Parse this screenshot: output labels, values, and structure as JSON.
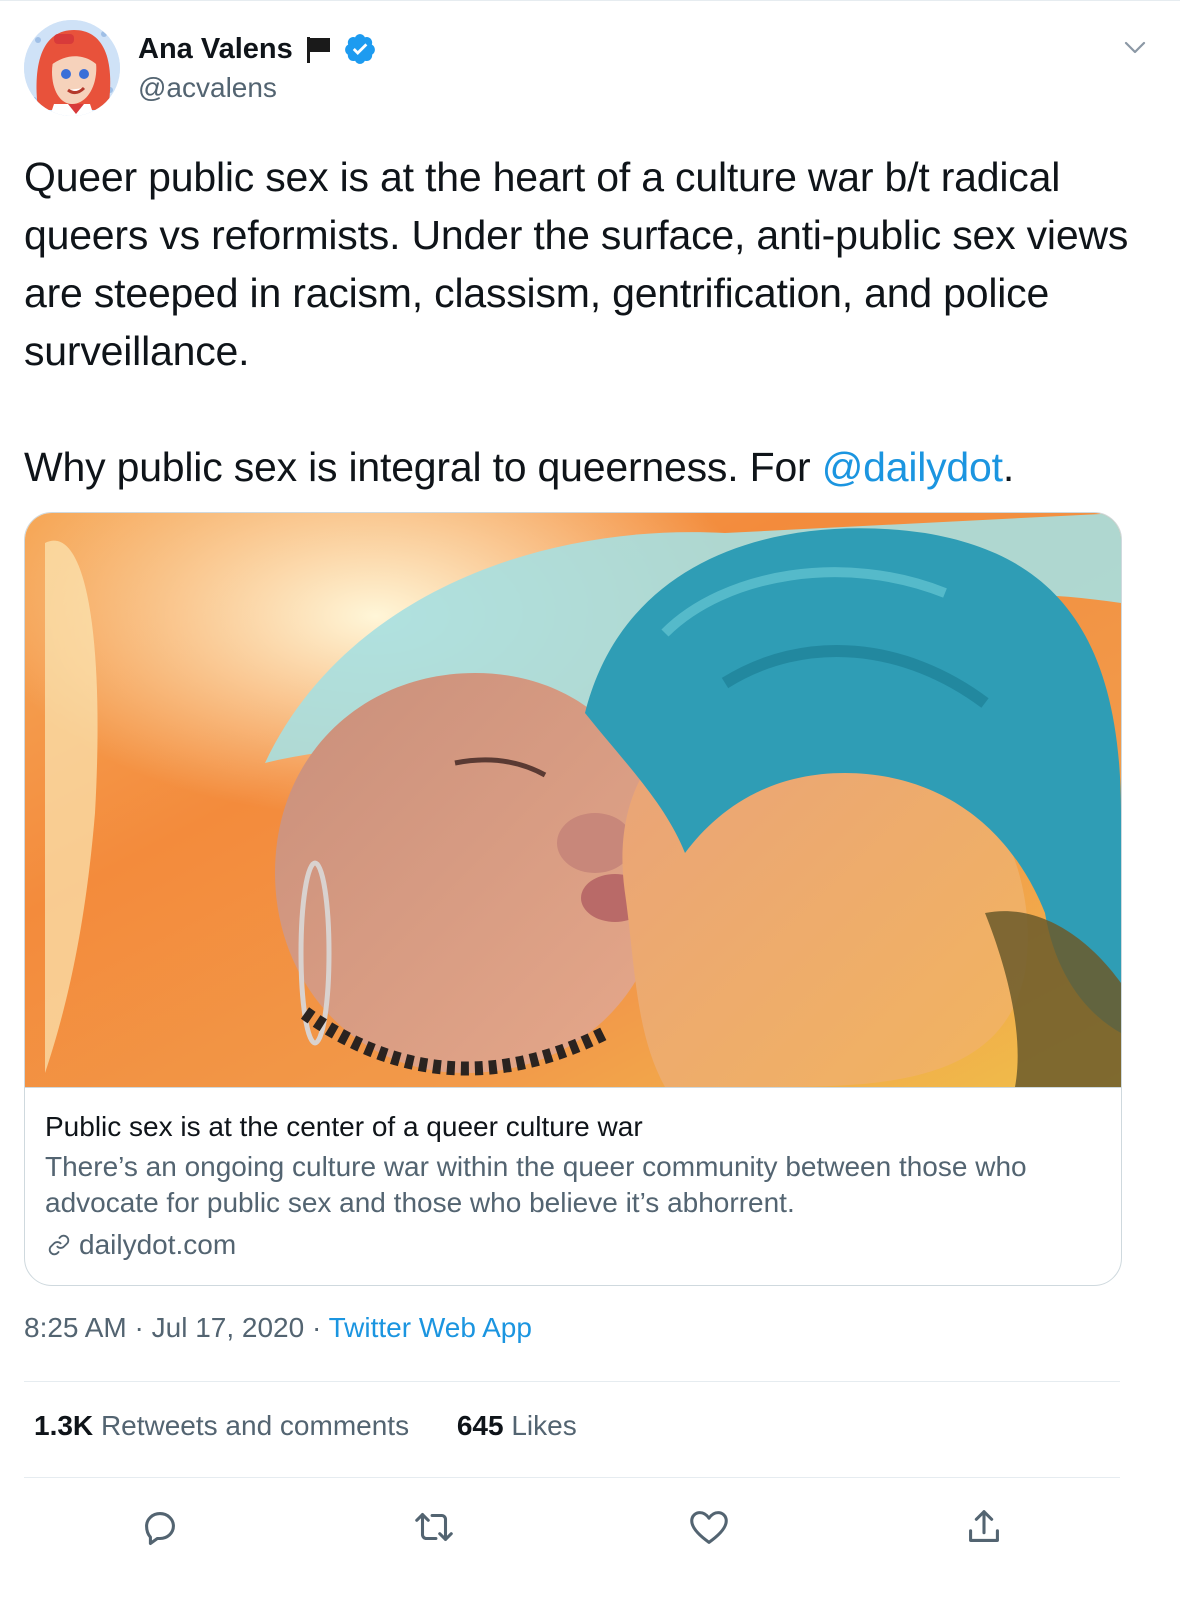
{
  "author": {
    "display_name": "Ana Valens",
    "handle": "@acvalens",
    "avatar_icon": "anime-avatar-icon",
    "flag_icon": "black-flag-icon",
    "verified_icon": "verified-badge-icon"
  },
  "tweet": {
    "paragraph1": "Queer public sex is at the heart of a culture war b/t radical queers vs reformists. Under the surface, anti-public sex views are steeped in racism, classism, gentrification, and police surveillance.",
    "paragraph2_prefix": "Why public sex is integral to queerness. For ",
    "mention": "@dailydot",
    "paragraph2_suffix": "."
  },
  "card": {
    "title": "Public sex is at the center of a queer culture war",
    "description": "There’s an ongoing culture war within the queer community between those who advocate for public sex and those who believe it’s abhorrent.",
    "domain": "dailydot.com"
  },
  "meta": {
    "time": "8:25 AM",
    "separator": " · ",
    "date": "Jul 17, 2020",
    "source": "Twitter Web App"
  },
  "stats": {
    "retweets_count": "1.3K",
    "retweets_label": "Retweets and comments",
    "likes_count": "645",
    "likes_label": "Likes"
  },
  "actions": [
    "reply-icon",
    "retweet-icon",
    "like-icon",
    "share-icon"
  ],
  "colors": {
    "link": "#1b95e0",
    "secondary_text": "#536471",
    "border": "#cfd9de",
    "verified": "#1d9bf0"
  }
}
